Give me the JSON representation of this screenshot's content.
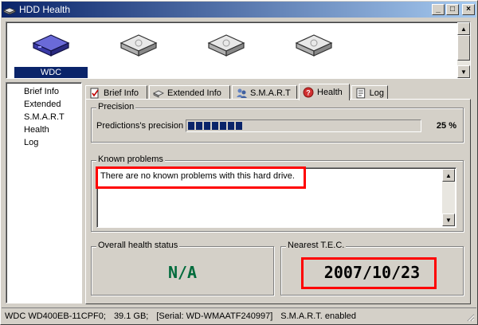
{
  "window": {
    "title": "HDD Health",
    "app_icon": "hdd-icon",
    "buttons": {
      "minimize": "_",
      "maximize": "□",
      "close": "×"
    }
  },
  "drives": [
    {
      "label": "WDC",
      "selected": true,
      "icon": "hdd-drive-icon-selected"
    },
    {
      "label": "",
      "selected": false,
      "icon": "hdd-drive-icon"
    },
    {
      "label": "",
      "selected": false,
      "icon": "hdd-drive-icon"
    },
    {
      "label": "",
      "selected": false,
      "icon": "hdd-drive-icon"
    }
  ],
  "nav": {
    "items": [
      {
        "label": "Brief Info"
      },
      {
        "label": "Extended"
      },
      {
        "label": "S.M.A.R.T"
      },
      {
        "label": "Health"
      },
      {
        "label": "Log"
      }
    ]
  },
  "tabs": [
    {
      "label": "Brief Info",
      "icon": "document-check-icon",
      "active": false
    },
    {
      "label": "Extended Info",
      "icon": "drive-small-icon",
      "active": false
    },
    {
      "label": "S.M.A.R.T",
      "icon": "people-icon",
      "active": false
    },
    {
      "label": "Health",
      "icon": "health-question-icon",
      "active": true
    },
    {
      "label": "Log",
      "icon": "log-icon",
      "active": false
    }
  ],
  "precision": {
    "group_title": "Precision",
    "label": "Predictions's precision",
    "value_text": "25 %",
    "value_fraction": 0.25,
    "bar_color": "#0a246a"
  },
  "known_problems": {
    "group_title": "Known problems",
    "text": "There are no known problems with this hard drive."
  },
  "overall_health": {
    "group_title": "Overall health status",
    "value": "N/A",
    "color": "#006b3c"
  },
  "nearest_tec": {
    "group_title": "Nearest T.E.C.",
    "value": "2007/10/23",
    "color": "#000000"
  },
  "status": {
    "model": "WDC WD400EB-11CPF0;",
    "size": "39.1 GB;",
    "serial": "[Serial: WD-WMAATF240997]",
    "smart": "S.M.A.R.T. enabled"
  },
  "highlight_color": "#ff0000"
}
